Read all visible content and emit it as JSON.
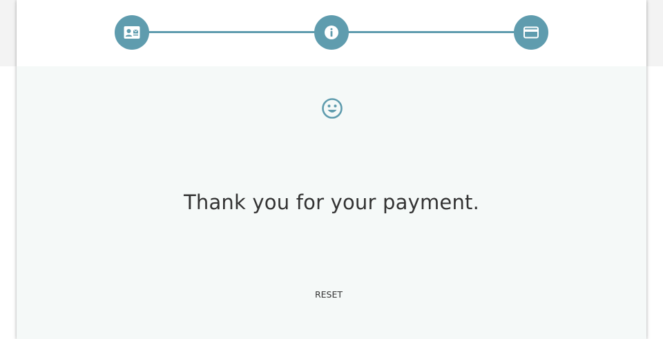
{
  "stepper": {
    "steps": [
      {
        "icon": "contact-card-icon",
        "state": "completed"
      },
      {
        "icon": "info-icon",
        "state": "completed"
      },
      {
        "icon": "credit-card-icon",
        "state": "completed"
      }
    ]
  },
  "result": {
    "icon": "smiley-face-icon",
    "message": "Thank you for your payment."
  },
  "actions": {
    "reset_label": "RESET"
  },
  "colors": {
    "accent": "#5f9cae",
    "content_background": "#f5f9f8",
    "text": "#333333"
  }
}
